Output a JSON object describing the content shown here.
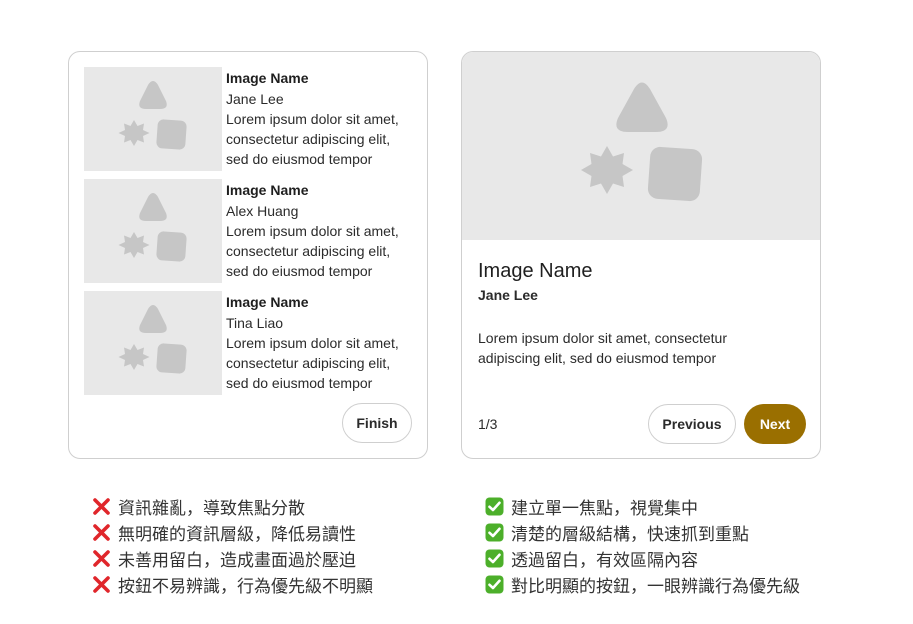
{
  "colors": {
    "accent": "#9a6f00",
    "placeholder_bg": "#e8e8e8",
    "placeholder_shape": "#c6c6c6",
    "bad_mark": "#e0262b",
    "good_mark": "#4caf2a"
  },
  "left_card": {
    "items": [
      {
        "title": "Image Name",
        "author": "Jane Lee",
        "desc": [
          "Lorem ipsum dolor sit amet,",
          "consectetur adipiscing elit,",
          "sed do eiusmod tempor"
        ]
      },
      {
        "title": "Image Name",
        "author": "Alex Huang",
        "desc": [
          "Lorem ipsum dolor sit amet,",
          "consectetur adipiscing elit,",
          "sed do eiusmod tempor"
        ]
      },
      {
        "title": "Image Name",
        "author": "Tina Liao",
        "desc": [
          "Lorem ipsum dolor sit amet,",
          "consectetur adipiscing elit,",
          "sed do eiusmod tempor"
        ]
      }
    ],
    "finish_label": "Finish"
  },
  "right_card": {
    "title": "Image Name",
    "author": "Jane Lee",
    "desc": [
      "Lorem ipsum dolor sit amet, consectetur",
      "adipiscing elit, sed do eiusmod tempor"
    ],
    "pager": "1/3",
    "previous_label": "Previous",
    "next_label": "Next"
  },
  "notes": {
    "bad": [
      "資訊雜亂，導致焦點分散",
      "無明確的資訊層級，降低易讀性",
      "未善用留白，造成畫面過於壓迫",
      "按鈕不易辨識，行為優先級不明顯"
    ],
    "good": [
      "建立單一焦點，視覺集中",
      "清楚的層級結構，快速抓到重點",
      "透過留白，有效區隔內容",
      "對比明顯的按鈕，一眼辨識行為優先級"
    ],
    "bad_icon": "cross-mark-icon",
    "good_icon": "check-mark-icon"
  }
}
